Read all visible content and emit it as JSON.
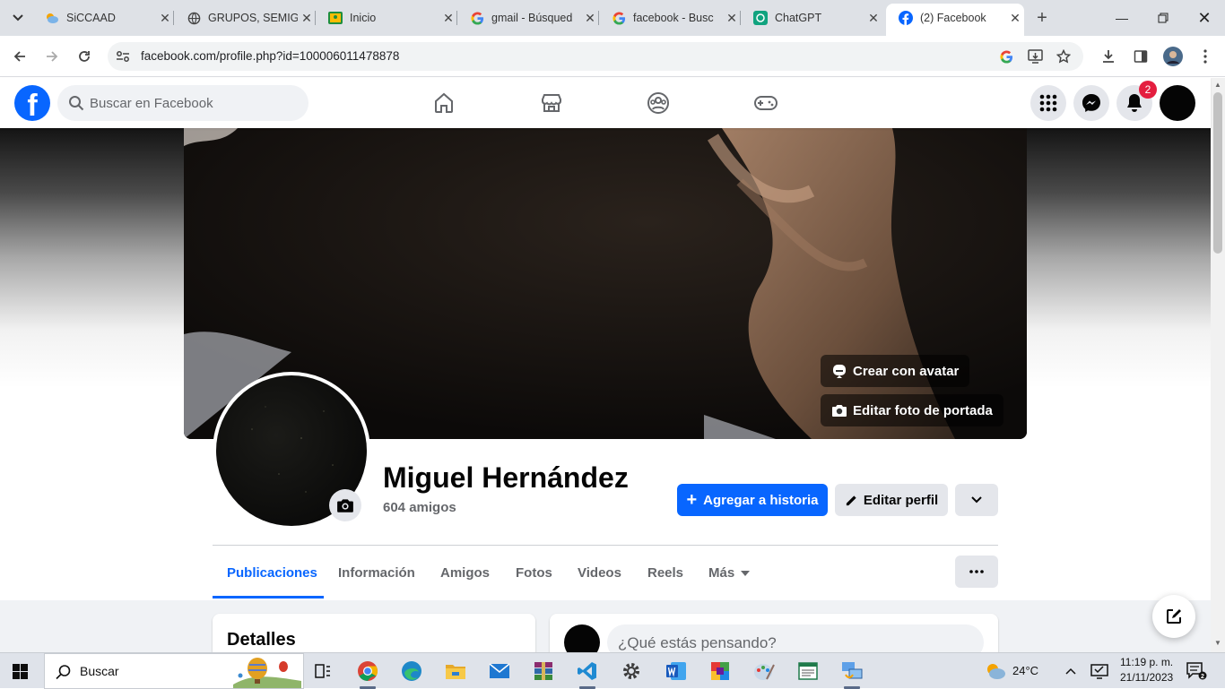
{
  "browser": {
    "tabs": [
      {
        "title": "SiCCAAD",
        "icon": "cloud-icon"
      },
      {
        "title": "GRUPOS, SEMIG",
        "icon": "globe-icon"
      },
      {
        "title": "Inicio",
        "icon": "classroom-icon"
      },
      {
        "title": "gmail - Búsqued",
        "icon": "google-icon"
      },
      {
        "title": "facebook - Busc",
        "icon": "google-icon"
      },
      {
        "title": "ChatGPT",
        "icon": "chatgpt-icon"
      },
      {
        "title": "(2) Facebook",
        "icon": "facebook-icon",
        "active": true
      }
    ],
    "url": "facebook.com/profile.php?id=100006011478878"
  },
  "fb_header": {
    "logo": "f",
    "search_placeholder": "Buscar en Facebook",
    "notifications_count": "2"
  },
  "profile": {
    "name": "Miguel Hernández",
    "friends": "604 amigos",
    "cover_buttons": {
      "create_avatar": "Crear con avatar",
      "edit_cover": "Editar foto de portada"
    },
    "actions": {
      "add_story": "Agregar a historia",
      "edit_profile": "Editar perfil"
    },
    "tabs": [
      "Publicaciones",
      "Información",
      "Amigos",
      "Fotos",
      "Videos",
      "Reels",
      "Más"
    ],
    "details_title": "Detalles",
    "composer_placeholder": "¿Qué estás pensando?"
  },
  "taskbar": {
    "search_placeholder": "Buscar",
    "weather": "24°C",
    "time": "11:19 p. m.",
    "date": "21/11/2023"
  },
  "colors": {
    "fb_blue": "#0866ff",
    "badge_red": "#e41e3f",
    "tab_bg": "#dee1e6"
  }
}
